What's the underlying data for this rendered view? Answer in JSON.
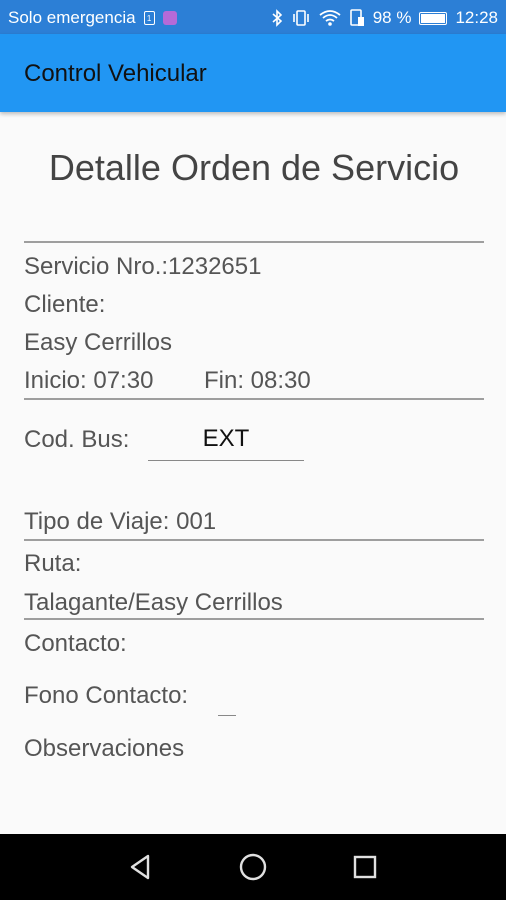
{
  "status_bar": {
    "carrier": "Solo emergencia",
    "battery": "98 %",
    "time": "12:28",
    "battery_level": 0.98
  },
  "app_bar": {
    "title": "Control Vehicular"
  },
  "detail": {
    "title": "Detalle Orden de Servicio",
    "service_number": "Servicio Nro.:1232651",
    "client_label": "Cliente:",
    "client_name": "Easy Cerrillos",
    "start_time": "Inicio: 07:30",
    "end_time": "Fin: 08:30",
    "bus_code_label": "Cod. Bus:",
    "bus_code_value": "EXT",
    "trip_type": "Tipo de Viaje: 001",
    "route_label": "Ruta:",
    "route_value": "Talagante/Easy Cerrillos",
    "contact_label": "Contacto:",
    "contact_phone_label": "Fono Contacto:",
    "contact_phone_value": "",
    "observations_label": "Observaciones"
  },
  "colors": {
    "primary": "#2196f3",
    "status_bar": "#2c7fd6",
    "divider": "#9e9e9e"
  },
  "icons": [
    "sim-icon",
    "app-notification-icon",
    "bluetooth-icon",
    "vibrate-icon",
    "wifi-icon",
    "sim-signal-icon",
    "battery-icon",
    "back-icon",
    "home-icon",
    "recents-icon"
  ]
}
